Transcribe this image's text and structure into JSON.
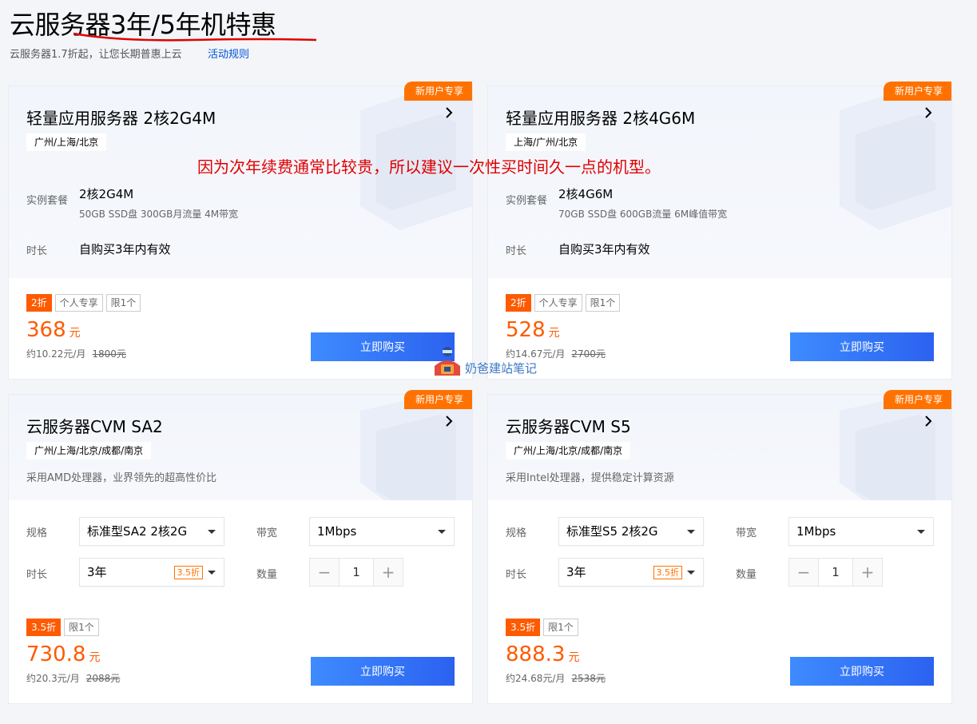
{
  "header": {
    "title": "云服务器3年/5年机特惠",
    "subtitle": "云服务器1.7折起，让您长期普惠上云",
    "rules_link": "活动规则"
  },
  "annotation": "因为次年续费通常比较贵，所以建议一次性买时间久一点的机型。",
  "watermark": "奶爸建站笔记",
  "cards": [
    {
      "badge": "新用户专享",
      "title": "轻量应用服务器 2核2G4M",
      "regions": "广州/上海/北京",
      "instance_label": "实例套餐",
      "instance_value": "2核2G4M",
      "instance_sub": "50GB SSD盘 300GB月流量 4M带宽",
      "duration_label": "时长",
      "duration_value": "自购买3年内有效",
      "tags": [
        "2折",
        "个人专享",
        "限1个"
      ],
      "price": "368",
      "price_unit": "元",
      "per_month": "约10.22元/月",
      "original": "1800元",
      "buy": "立即购买"
    },
    {
      "badge": "新用户专享",
      "title": "轻量应用服务器 2核4G6M",
      "regions": "上海/广州/北京",
      "instance_label": "实例套餐",
      "instance_value": "2核4G6M",
      "instance_sub": "70GB SSD盘 600GB流量 6M峰值带宽",
      "duration_label": "时长",
      "duration_value": "自购买3年内有效",
      "tags": [
        "2折",
        "个人专享",
        "限1个"
      ],
      "price": "528",
      "price_unit": "元",
      "per_month": "约14.67元/月",
      "original": "2700元",
      "buy": "立即购买"
    },
    {
      "badge": "新用户专享",
      "title": "云服务器CVM SA2",
      "regions": "广州/上海/北京/成都/南京",
      "desc": "采用AMD处理器，业界领先的超高性价比",
      "spec_label": "规格",
      "spec_value": "标准型SA2 2核2G",
      "bandwidth_label": "带宽",
      "bandwidth_value": "1Mbps",
      "duration_label": "时长",
      "duration_value": "3年",
      "duration_tag": "3.5折",
      "qty_label": "数量",
      "qty_value": "1",
      "tags": [
        "3.5折",
        "限1个"
      ],
      "price": "730.8",
      "price_unit": "元",
      "per_month": "约20.3元/月",
      "original": "2088元",
      "buy": "立即购买"
    },
    {
      "badge": "新用户专享",
      "title": "云服务器CVM S5",
      "regions": "广州/上海/北京/成都/南京",
      "desc": "采用Intel处理器，提供稳定计算资源",
      "spec_label": "规格",
      "spec_value": "标准型S5 2核2G",
      "bandwidth_label": "带宽",
      "bandwidth_value": "1Mbps",
      "duration_label": "时长",
      "duration_value": "3年",
      "duration_tag": "3.5折",
      "qty_label": "数量",
      "qty_value": "1",
      "tags": [
        "3.5折",
        "限1个"
      ],
      "price": "888.3",
      "price_unit": "元",
      "per_month": "约24.68元/月",
      "original": "2538元",
      "buy": "立即购买"
    }
  ]
}
